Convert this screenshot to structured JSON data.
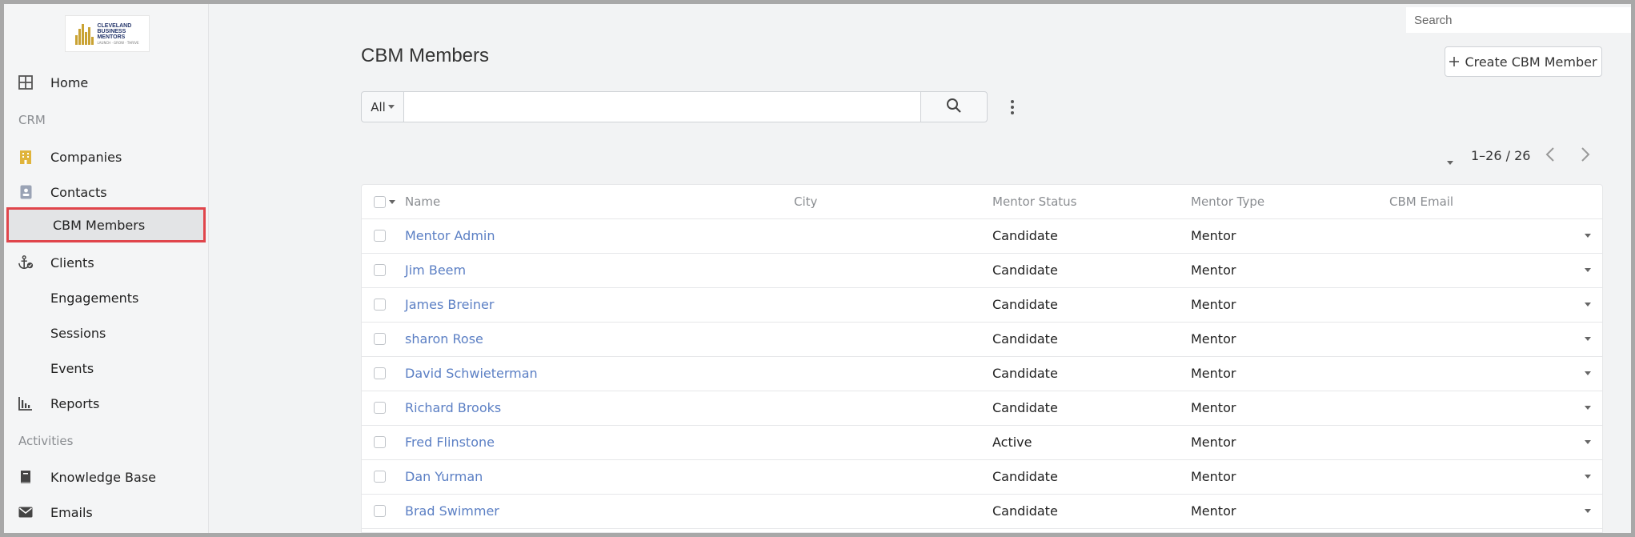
{
  "logo": {
    "line1": "CLEVELAND",
    "line2": "BUSINESS",
    "line3": "MENTORS",
    "tagline": "LAUNCH · GROW · THRIVE"
  },
  "sidebar": {
    "items": [
      {
        "label": "Home",
        "icon": "grid-icon"
      },
      {
        "section": "CRM"
      },
      {
        "label": "Companies",
        "icon": "building-icon"
      },
      {
        "label": "Contacts",
        "icon": "contact-card-icon"
      },
      {
        "label": "CBM Members",
        "icon": "",
        "active": true
      },
      {
        "label": "Clients",
        "icon": "anchor-icon"
      },
      {
        "label": "Engagements",
        "icon": ""
      },
      {
        "label": "Sessions",
        "icon": ""
      },
      {
        "label": "Events",
        "icon": ""
      },
      {
        "label": "Reports",
        "icon": "bar-chart-icon"
      },
      {
        "section": "Activities"
      },
      {
        "label": "Knowledge Base",
        "icon": "book-icon"
      },
      {
        "label": "Emails",
        "icon": "envelope-icon"
      }
    ]
  },
  "header": {
    "search_placeholder": "Search"
  },
  "main": {
    "title": "CBM Members",
    "create_label": "Create CBM Member",
    "filter_label": "All",
    "pagination": "1–26 / 26"
  },
  "table": {
    "columns": [
      "Name",
      "City",
      "Mentor Status",
      "Mentor Type",
      "CBM Email"
    ],
    "rows": [
      {
        "name": "Mentor Admin",
        "city": "",
        "status": "Candidate",
        "type": "Mentor",
        "email": ""
      },
      {
        "name": "Jim Beem",
        "city": "",
        "status": "Candidate",
        "type": "Mentor",
        "email": ""
      },
      {
        "name": "James Breiner",
        "city": "",
        "status": "Candidate",
        "type": "Mentor",
        "email": ""
      },
      {
        "name": "sharon Rose",
        "city": "",
        "status": "Candidate",
        "type": "Mentor",
        "email": ""
      },
      {
        "name": "David Schwieterman",
        "city": "",
        "status": "Candidate",
        "type": "Mentor",
        "email": ""
      },
      {
        "name": "Richard Brooks",
        "city": "",
        "status": "Candidate",
        "type": "Mentor",
        "email": ""
      },
      {
        "name": "Fred Flinstone",
        "city": "",
        "status": "Active",
        "type": "Mentor",
        "email": ""
      },
      {
        "name": "Dan Yurman",
        "city": "",
        "status": "Candidate",
        "type": "Mentor",
        "email": ""
      },
      {
        "name": "Brad Swimmer",
        "city": "",
        "status": "Candidate",
        "type": "Mentor",
        "email": ""
      }
    ]
  },
  "colors": {
    "accent_link": "#5b7fc4",
    "active_outline": "#e0454b",
    "companies_icon": "#e0b43c"
  }
}
